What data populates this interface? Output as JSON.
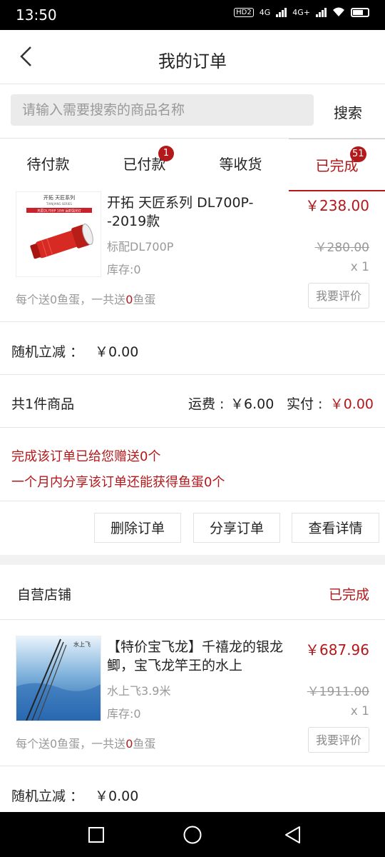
{
  "status": {
    "time": "13:50",
    "hd": "HD2",
    "net1": "4G",
    "net2": "4G+"
  },
  "header": {
    "title": "我的订单"
  },
  "search": {
    "placeholder": "请输入需要搜索的商品名称",
    "button": "搜索"
  },
  "tabs": [
    {
      "label": "待付款",
      "badge": ""
    },
    {
      "label": "已付款",
      "badge": "1"
    },
    {
      "label": "等收货",
      "badge": ""
    },
    {
      "label": "已完成",
      "badge": "51",
      "active": true
    }
  ],
  "order1": {
    "product": {
      "image_text": {
        "top": "开拓 天匠系列",
        "sub": "TIANJIANG SERIES",
        "banner": "天匠DL700P 10W 远射强光灯"
      },
      "name": "开拓 天匠系列 DL700P--2019款",
      "price": "￥238.00",
      "spec": "标配DL700P",
      "orig_price": "￥280.00",
      "stock": "库存:0",
      "qty": "x 1",
      "gift_a": "每个送0鱼蛋，一共送",
      "gift_n": "0",
      "gift_b": "鱼蛋",
      "rate": "我要评价"
    },
    "discount": {
      "label": "随机立减 ：",
      "value": "￥0.00"
    },
    "summary": {
      "count": "共1件商品",
      "shipping_label": "运费 :",
      "shipping": "￥6.00",
      "paid_label": "实付 :",
      "paid": "￥0.00"
    },
    "notice": {
      "line1": "完成该订单已给您赠送0个",
      "line2": "一个月内分享该订单还能获得鱼蛋0个"
    },
    "buttons": {
      "delete": "删除订单",
      "share": "分享订单",
      "detail": "查看详情"
    }
  },
  "order2": {
    "shop": "自营店铺",
    "status": "已完成",
    "product": {
      "image_text": "水上飞",
      "name": "【特价宝飞龙】千禧龙的银龙鲫，宝飞龙竿王的水上",
      "price": "￥687.96",
      "spec": "水上飞3.9米",
      "orig_price": "￥1911.00",
      "stock": "库存:0",
      "qty": "x 1",
      "gift_a": "每个送0鱼蛋，一共送",
      "gift_n": "0",
      "gift_b": "鱼蛋",
      "rate": "我要评价"
    },
    "discount": {
      "label": "随机立减 ：",
      "value": "￥0.00"
    }
  },
  "colors": {
    "accent": "#b3181b",
    "muted": "#999999",
    "divider": "#e6e6e6"
  }
}
